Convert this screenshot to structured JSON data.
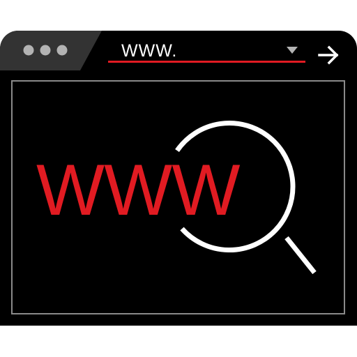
{
  "address_bar": {
    "url_text": "WWW."
  },
  "content": {
    "headline": "WWW"
  },
  "colors": {
    "window": "#000000",
    "accent": "#e11b22",
    "tab_strip": "#333333",
    "dots": "#b3b3b3",
    "border": "#8a8a8a",
    "foreground": "#ffffff"
  },
  "icons": {
    "window_controls": "three-dot-icon",
    "dropdown": "caret-down-icon",
    "go": "arrow-right-icon",
    "search": "magnifier-icon"
  }
}
